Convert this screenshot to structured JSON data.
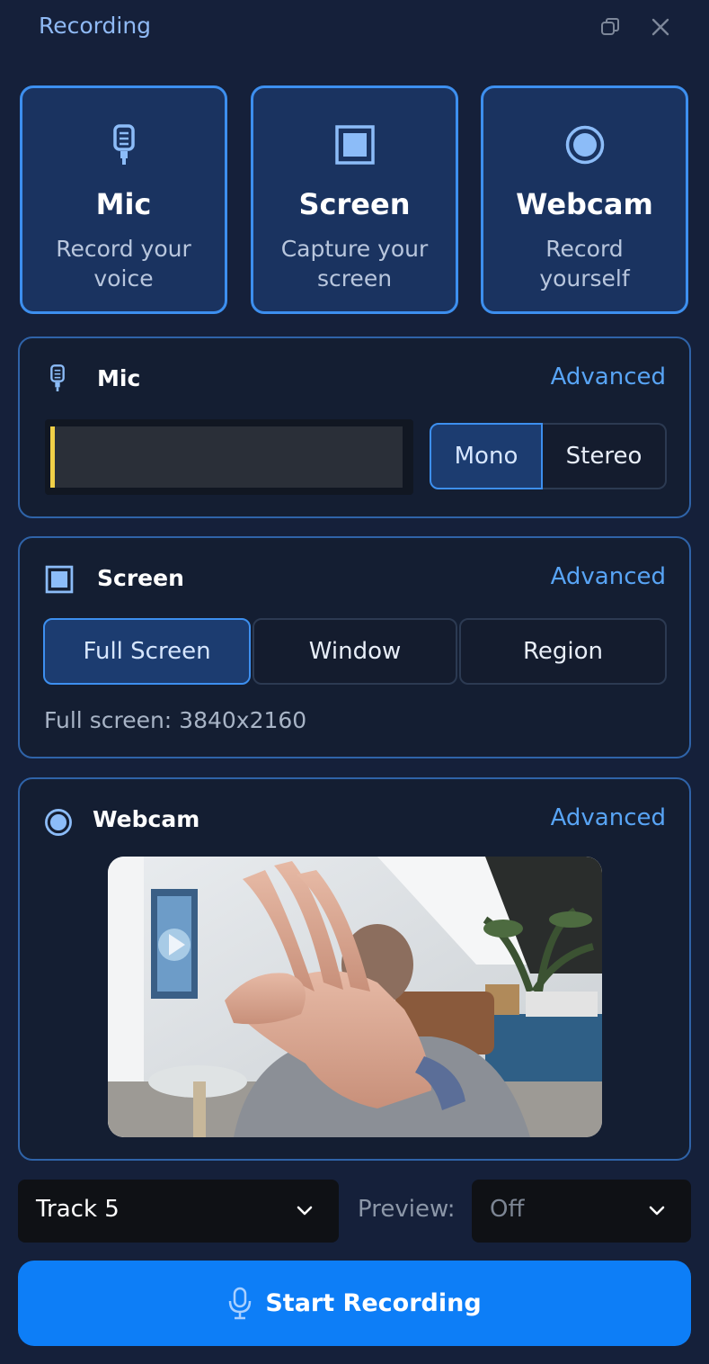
{
  "window": {
    "title": "Recording"
  },
  "modes": [
    {
      "name": "Mic",
      "desc": "Record your voice",
      "icon": "microphone-icon"
    },
    {
      "name": "Screen",
      "desc": "Capture your screen",
      "icon": "screen-icon"
    },
    {
      "name": "Webcam",
      "desc": "Record yourself",
      "icon": "webcam-icon"
    }
  ],
  "mic": {
    "title": "Mic",
    "advanced": "Advanced",
    "level": 0.01,
    "channels": [
      "Mono",
      "Stereo"
    ],
    "selected_channel": "Mono"
  },
  "screen": {
    "title": "Screen",
    "advanced": "Advanced",
    "options": [
      "Full Screen",
      "Window",
      "Region"
    ],
    "selected_option": "Full Screen",
    "info": "Full screen: 3840x2160"
  },
  "webcam": {
    "title": "Webcam",
    "advanced": "Advanced"
  },
  "footer": {
    "track": "Track 5",
    "preview_label": "Preview:",
    "preview_value": "Off",
    "start_label": "Start Recording"
  },
  "colors": {
    "accent": "#3d8fef",
    "primary_button": "#0d7ef7",
    "link": "#58a4f5",
    "level_meter": "#f0d048"
  }
}
